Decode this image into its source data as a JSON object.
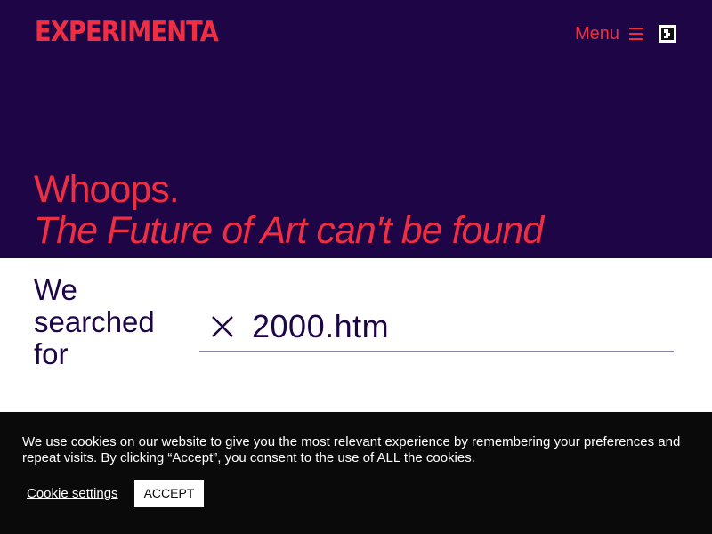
{
  "header": {
    "logo_text": "EXPERIMENTA",
    "menu_label": "Menu",
    "menu_icon": "hamburger-icon",
    "accessibility_icon": "accessibility-icon"
  },
  "hero": {
    "line1": "Whoops.",
    "line2": "The Future of Art can't be found"
  },
  "search": {
    "label": "We searched for",
    "value": "2000.htm",
    "clear_icon": "close-icon"
  },
  "cookie_banner": {
    "text": "We use cookies on our website to give you the most relevant experience by remembering your preferences and repeat visits. By clicking “Accept”, you consent to the use of ALL the cookies.",
    "settings_label": "Cookie settings",
    "accept_label": "ACCEPT"
  },
  "colors": {
    "hero_background": "#1e0545",
    "accent": "#ee2f43",
    "banner_background": "#0a0a0a",
    "text_dark": "#1e0545"
  }
}
